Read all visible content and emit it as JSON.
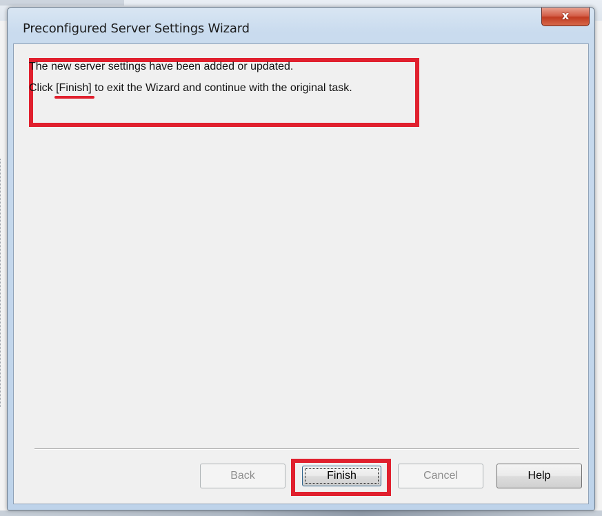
{
  "dialog": {
    "title": "Preconfigured Server Settings Wizard",
    "close_glyph": "x",
    "close_icon": "close-icon"
  },
  "message": {
    "line1": "The new server settings have been added or updated.",
    "line2_prefix": "Click ",
    "line2_finish": "[Finish]",
    "line2_suffix": " to exit the Wizard and continue with the original task."
  },
  "buttons": {
    "back": {
      "label": "Back",
      "enabled": false
    },
    "finish": {
      "label": "Finish",
      "enabled": true,
      "focused": true
    },
    "cancel": {
      "label": "Cancel",
      "enabled": false
    },
    "help": {
      "label": "Help",
      "enabled": true
    }
  },
  "colors": {
    "highlight": "#e0202e",
    "client_background": "#f0f0f0",
    "close_button": "#c13c22"
  }
}
